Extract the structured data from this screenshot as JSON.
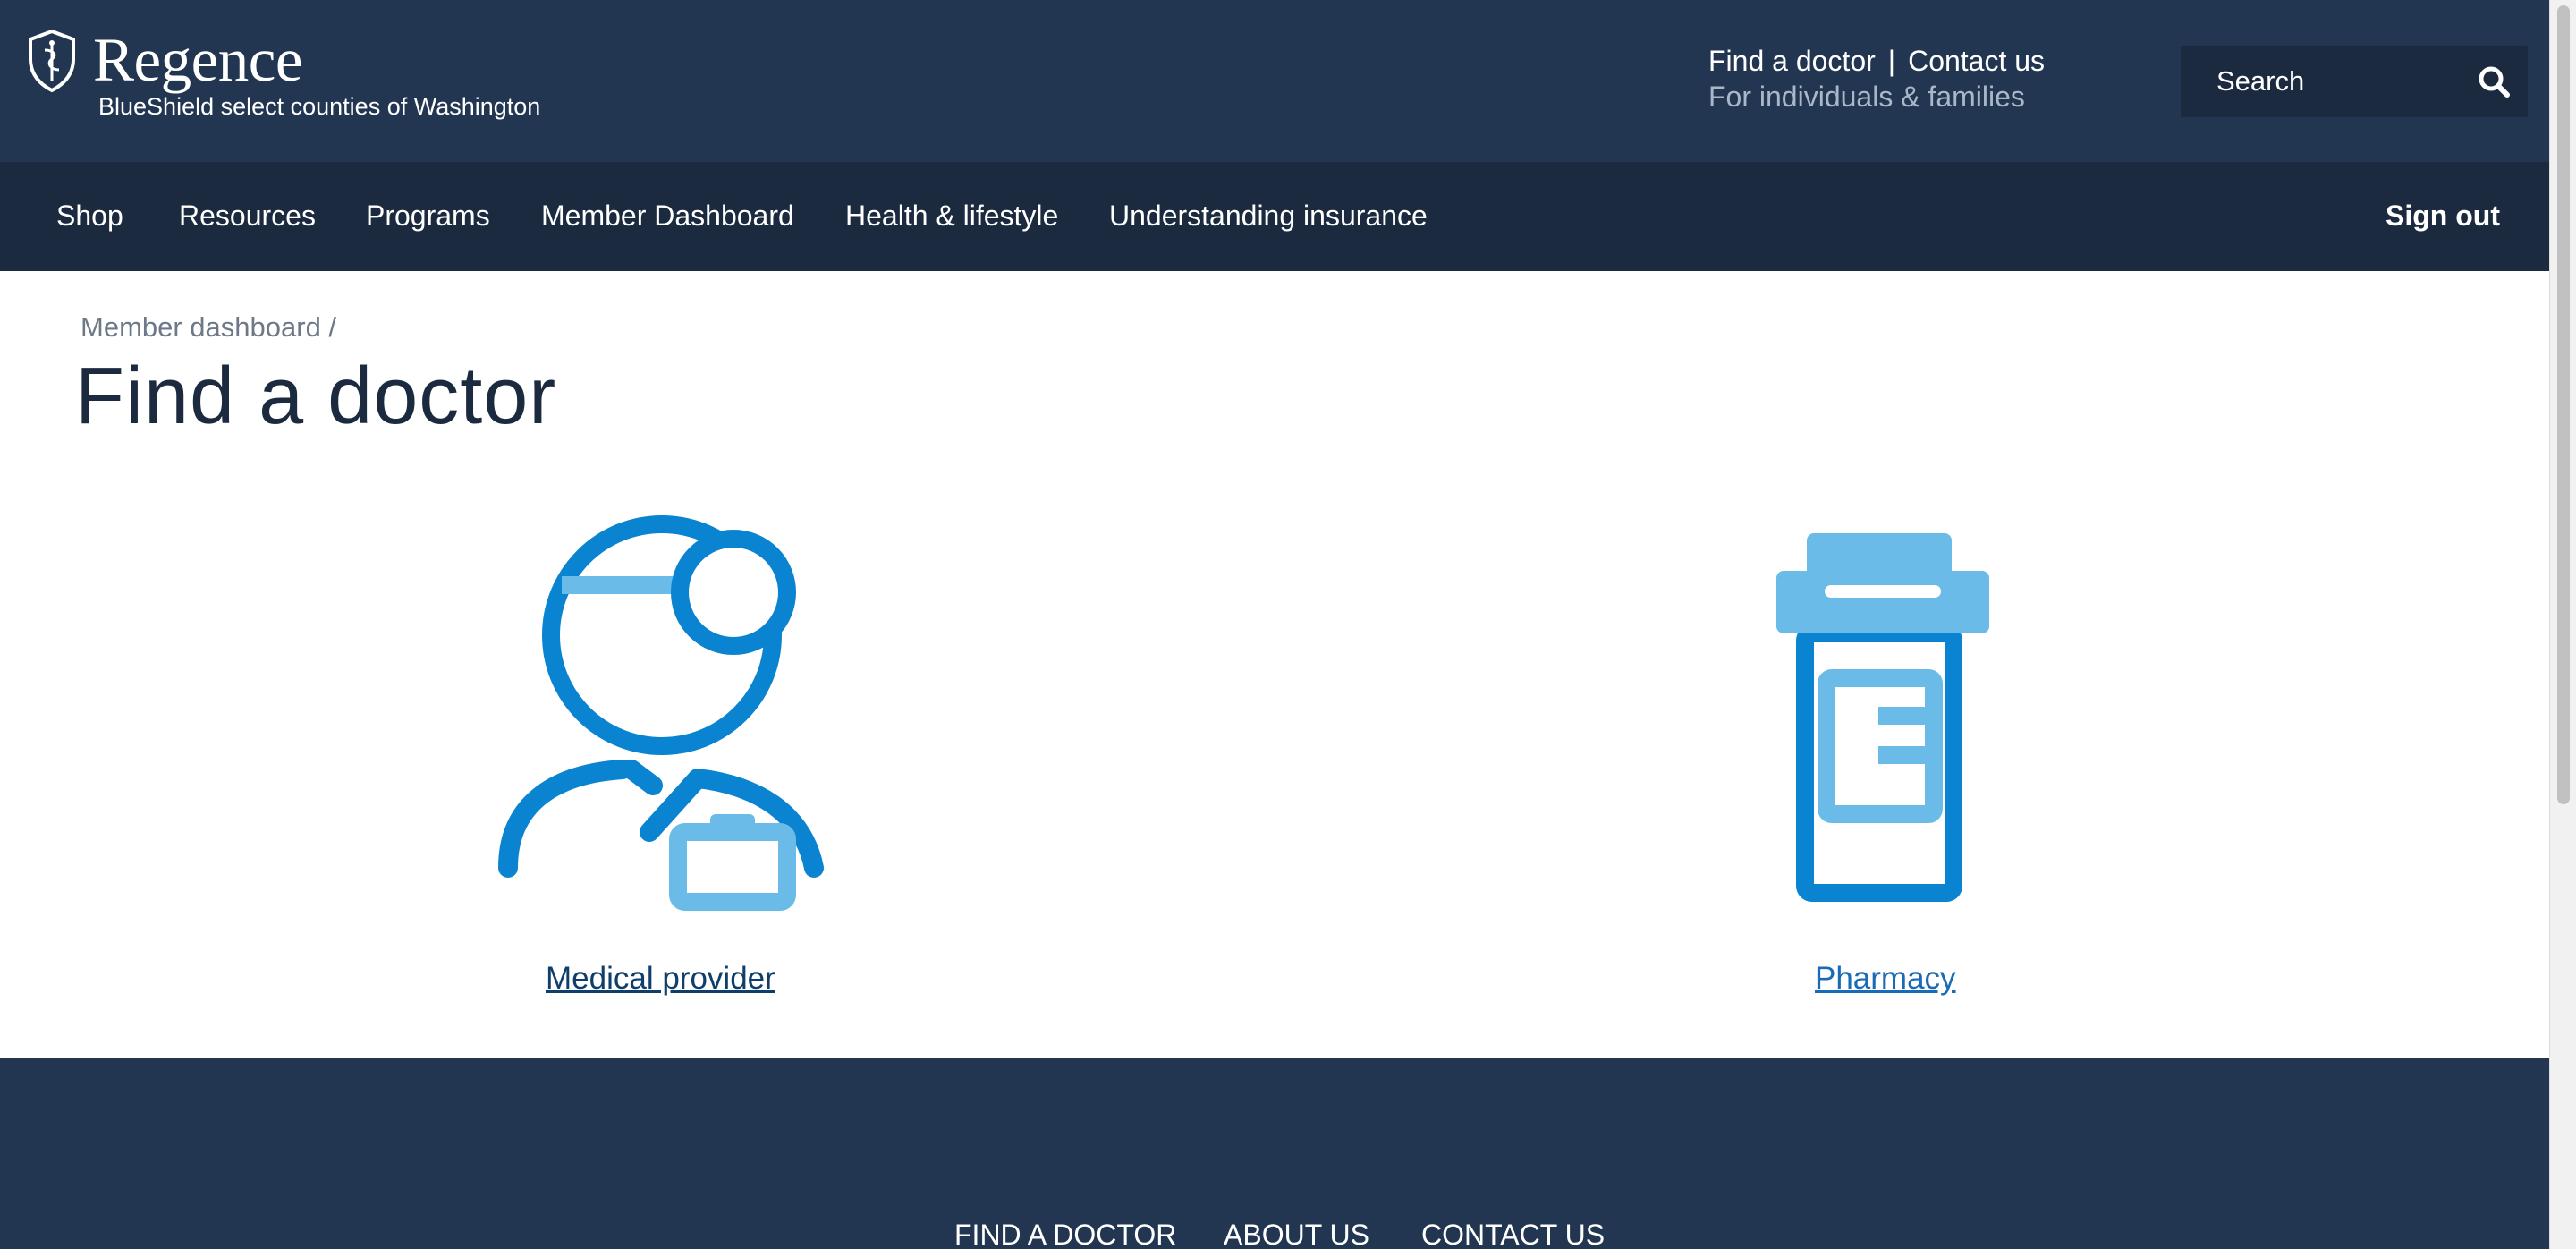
{
  "header": {
    "logo_text": "Regence",
    "logo_subtitle": "BlueShield select counties of Washington",
    "util_links": [
      "Find a doctor",
      "Contact us"
    ],
    "util_separator": "|",
    "audience_link": "For individuals & families",
    "search_placeholder": "Search"
  },
  "nav": {
    "items": [
      "Shop",
      "Resources",
      "Programs",
      "Member Dashboard",
      "Health & lifestyle",
      "Understanding insurance"
    ],
    "sign_out": "Sign out"
  },
  "breadcrumb": "Member dashboard /",
  "page_title": "Find a doctor",
  "cards": [
    {
      "label": "Medical provider",
      "icon": "doctor-icon",
      "link_color": "#0f3e6b"
    },
    {
      "label": "Pharmacy",
      "icon": "pill-bottle-icon",
      "link_color": "#1a6bb5"
    }
  ],
  "footer": {
    "links": [
      "FIND A DOCTOR",
      "ABOUT US",
      "CONTACT US"
    ]
  },
  "colors": {
    "header_bg": "#223651",
    "nav_bg": "#1b2a3f",
    "icon_dark_blue": "#0a84d0",
    "icon_light_blue": "#6bbbe8"
  }
}
